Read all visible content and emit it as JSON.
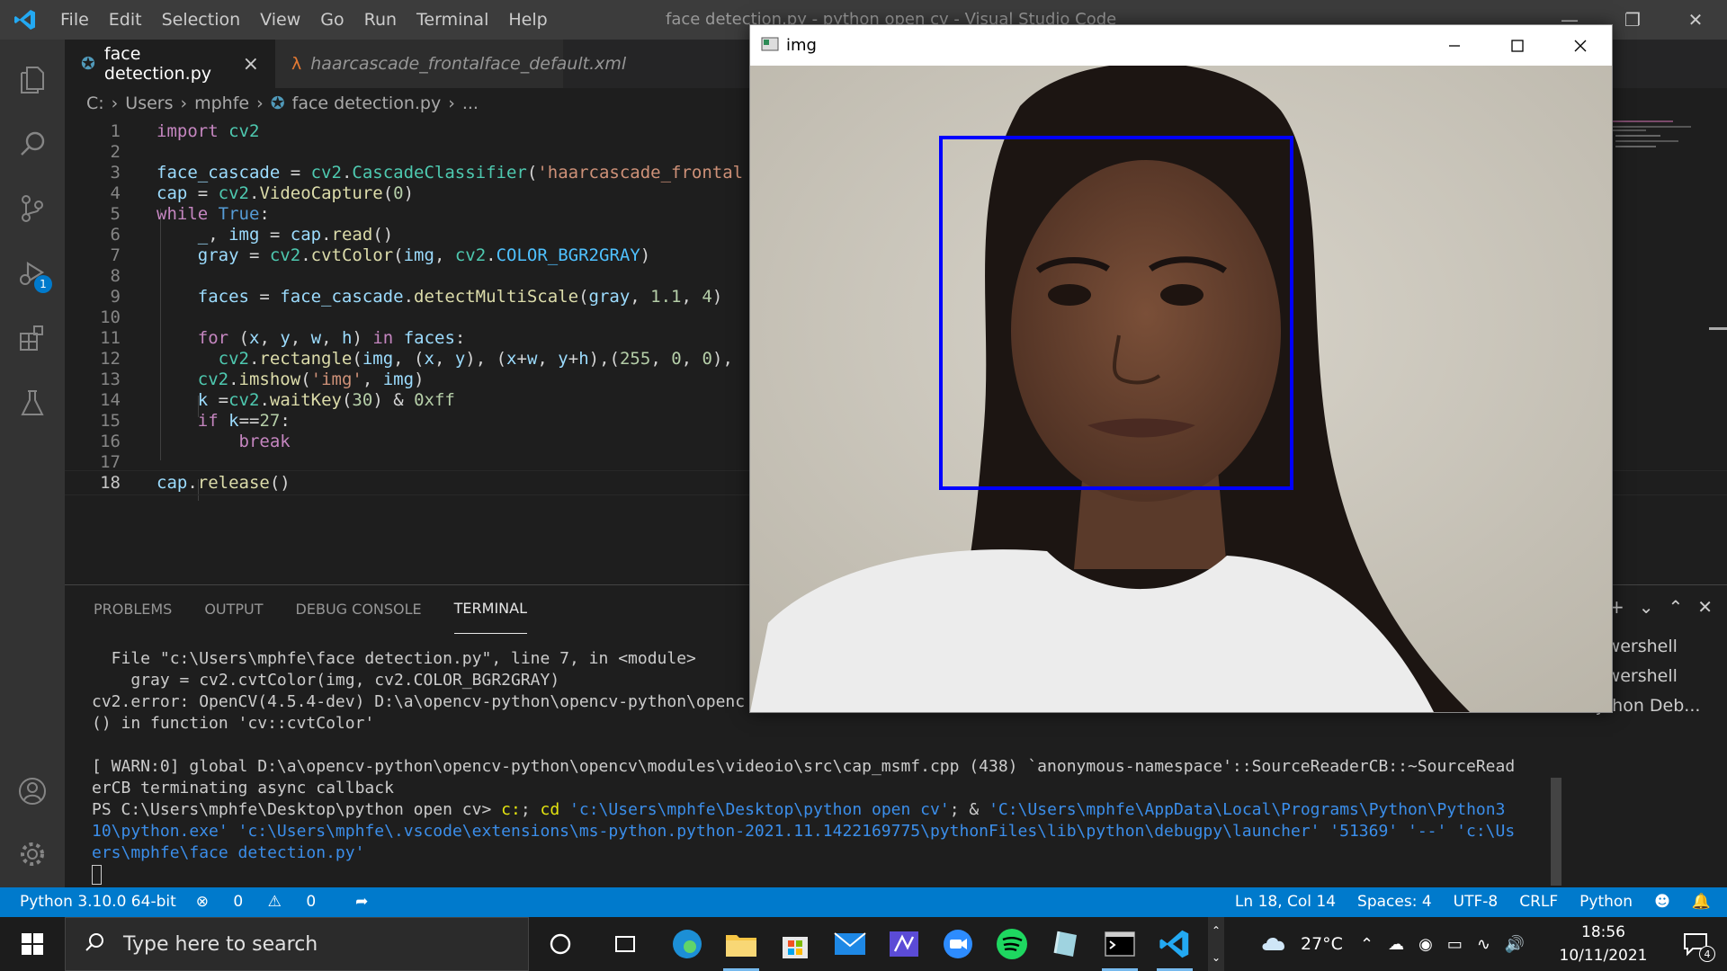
{
  "window": {
    "title": "face detection.py - python open cv - Visual Studio Code",
    "menu": [
      "File",
      "Edit",
      "Selection",
      "View",
      "Go",
      "Run",
      "Terminal",
      "Help"
    ]
  },
  "activity": {
    "debug_badge": "1"
  },
  "tabs": [
    {
      "label": "face detection.py",
      "close": "×"
    },
    {
      "label": "haarcascade_frontalface_default.xml"
    }
  ],
  "breadcrumb": [
    "C:",
    "Users",
    "mphfe",
    "face detection.py",
    "..."
  ],
  "editor": {
    "line_numbers": [
      "1",
      "2",
      "3",
      "4",
      "5",
      "6",
      "7",
      "8",
      "9",
      "10",
      "11",
      "12",
      "13",
      "14",
      "15",
      "16",
      "17",
      "18"
    ],
    "current_line": "18",
    "lines": [
      "import cv2",
      "",
      "face_cascade = cv2.CascadeClassifier('haarcascade_frontal",
      "cap = cv2.VideoCapture(0)",
      "while True:",
      "    _, img = cap.read()",
      "    gray = cv2.cvtColor(img, cv2.COLOR_BGR2GRAY)",
      "",
      "    faces = face_cascade.detectMultiScale(gray, 1.1, 4)",
      "",
      "    for (x, y, w, h) in faces:",
      "      cv2.rectangle(img, (x, y), (x+w, y+h),(255, 0, 0),",
      "    cv2.imshow('img', img)",
      "    k =cv2.waitKey(30) & 0xff",
      "    if k==27:",
      "        break",
      "",
      "cap.release()"
    ]
  },
  "panel": {
    "tabs": [
      "PROBLEMS",
      "OUTPUT",
      "DEBUG CONSOLE",
      "TERMINAL"
    ],
    "active_tab": "TERMINAL",
    "terminals": [
      "powershell",
      "powershell",
      "Python Deb..."
    ],
    "terminal_lines": [
      "  File \"c:\\Users\\mphfe\\face detection.py\", line 7, in <module>",
      "    gray = cv2.cvtColor(img, cv2.COLOR_BGR2GRAY)",
      "cv2.error: OpenCV(4.5.4-dev) D:\\a\\opencv-python\\opencv-python\\openc",
      "() in function 'cv::cvtColor'",
      "",
      "[ WARN:0] global D:\\a\\opencv-python\\opencv-python\\opencv\\modules\\videoio\\src\\cap_msmf.cpp (438) `anonymous-namespace'::SourceReaderCB::~SourceRead",
      "erCB terminating async callback"
    ],
    "prompt": "PS C:\\Users\\mphfe\\Desktop\\python open cv> ",
    "cmd_a": "c:",
    "cmd_b": "; ",
    "cmd_c": "cd",
    "cmd_path": " 'c:\\Users\\mphfe\\Desktop\\python open cv'",
    "cmd_rest": "; & ",
    "cmd_exe": "'C:\\Users\\mphfe\\AppData\\Local\\Programs\\Python\\Python3",
    "cmd_line2": "10\\python.exe' 'c:\\Users\\mphfe\\.vscode\\extensions\\ms-python.python-2021.11.1422169775\\pythonFiles\\lib\\python\\debugpy\\launcher' '51369' '--' 'c:\\Us",
    "cmd_line3": "ers\\mphfe\\face detection.py'"
  },
  "statusbar": {
    "interpreter": "Python 3.10.0 64-bit",
    "errors": "0",
    "warnings": "0",
    "position": "Ln 18, Col 14",
    "spaces": "Spaces: 4",
    "encoding": "UTF-8",
    "eol": "CRLF",
    "language": "Python"
  },
  "imgwindow": {
    "title": "img"
  },
  "taskbar": {
    "search_placeholder": "Type here to search",
    "temperature": "27°C",
    "time": "18:56",
    "date": "10/11/2021",
    "notifications": "4"
  },
  "colors": {
    "accent": "#007acc",
    "detection_box": "#0000ff"
  }
}
